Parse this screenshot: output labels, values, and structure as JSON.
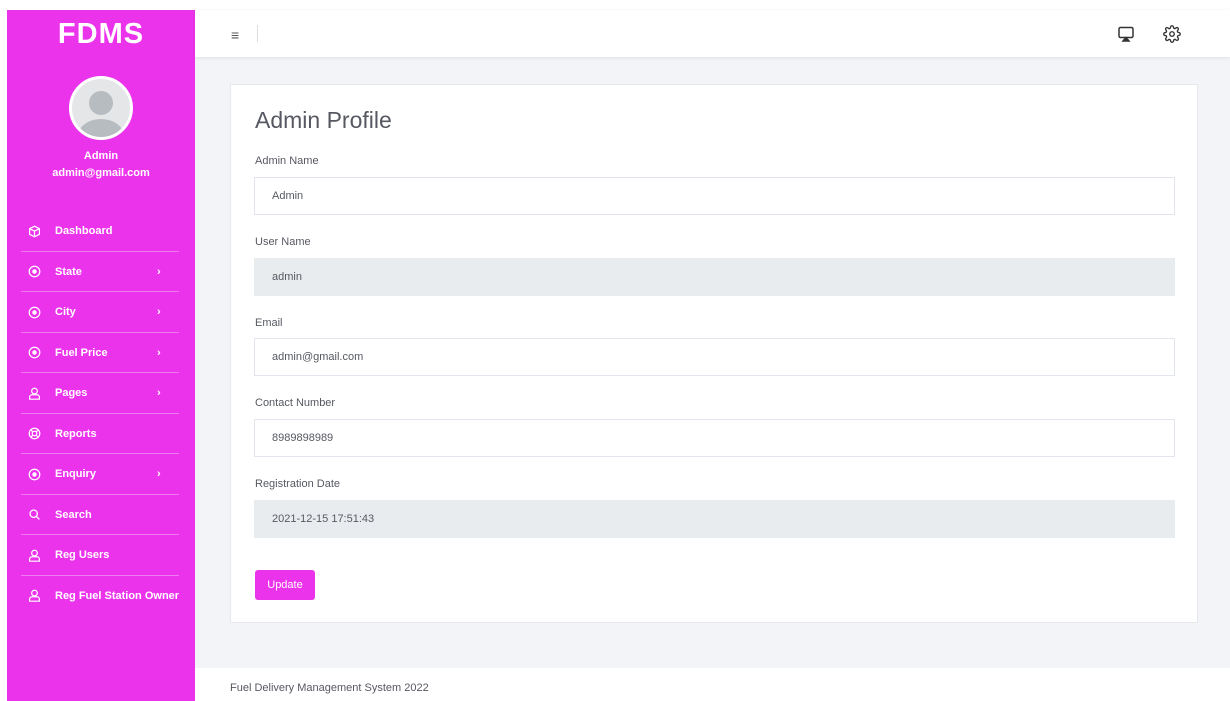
{
  "sidebar": {
    "brand": "FDMS",
    "user": {
      "name": "Admin",
      "email": "admin@gmail.com"
    },
    "items": [
      {
        "label": "Dashboard",
        "icon": "box-icon",
        "has_submenu": false
      },
      {
        "label": "State",
        "icon": "circle-dot-icon",
        "has_submenu": true
      },
      {
        "label": "City",
        "icon": "circle-dot-icon",
        "has_submenu": true
      },
      {
        "label": "Fuel Price",
        "icon": "circle-dot-icon",
        "has_submenu": true
      },
      {
        "label": "Pages",
        "icon": "user-icon",
        "has_submenu": true
      },
      {
        "label": "Reports",
        "icon": "life-ring-icon",
        "has_submenu": false
      },
      {
        "label": "Enquiry",
        "icon": "circle-dot-icon",
        "has_submenu": true
      },
      {
        "label": "Search",
        "icon": "search-icon",
        "has_submenu": false
      },
      {
        "label": "Reg Users",
        "icon": "user-icon",
        "has_submenu": false
      },
      {
        "label": "Reg Fuel Station Owner",
        "icon": "user-icon",
        "has_submenu": false
      }
    ],
    "chevron": "›"
  },
  "topbar": {
    "menu_icon": "≡",
    "icons": [
      "cast-icon",
      "gear-icon"
    ]
  },
  "profile": {
    "title": "Admin Profile",
    "fields": [
      {
        "label": "Admin Name",
        "value": "Admin",
        "readonly": false
      },
      {
        "label": "User Name",
        "value": "admin",
        "readonly": true
      },
      {
        "label": "Email",
        "value": "admin@gmail.com",
        "readonly": false
      },
      {
        "label": "Contact Number",
        "value": "8989898989",
        "readonly": false
      },
      {
        "label": "Registration Date",
        "value": "2021-12-15 17:51:43",
        "readonly": true
      }
    ],
    "update_label": "Update"
  },
  "footer": {
    "text": "Fuel Delivery Management System 2022"
  },
  "colors": {
    "accent": "#ec33ec",
    "background": "#f2f4f7",
    "text": "#575962"
  }
}
